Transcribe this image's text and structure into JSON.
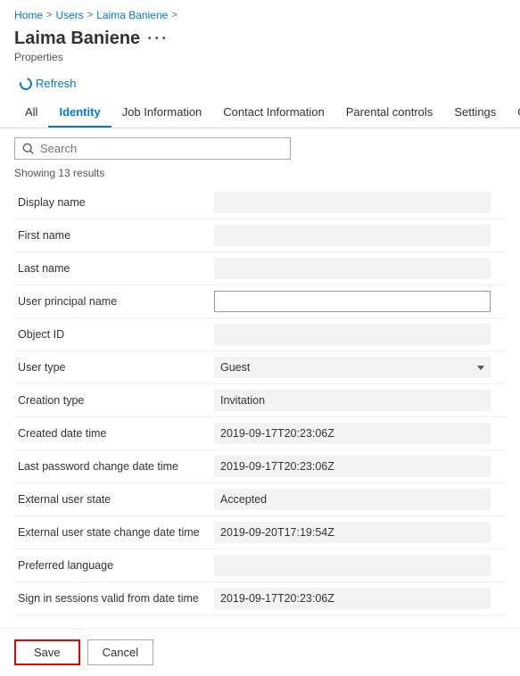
{
  "breadcrumb": {
    "home": "Home",
    "users": "Users",
    "current": "Laima Baniene",
    "sep": ">"
  },
  "page": {
    "title": "Laima Baniene",
    "ellipsis": "···",
    "subtitle": "Properties"
  },
  "toolbar": {
    "refresh_label": "Refresh"
  },
  "tabs": [
    {
      "id": "all",
      "label": "All",
      "active": false
    },
    {
      "id": "identity",
      "label": "Identity",
      "active": true
    },
    {
      "id": "job",
      "label": "Job Information",
      "active": false
    },
    {
      "id": "contact",
      "label": "Contact Information",
      "active": false
    },
    {
      "id": "parental",
      "label": "Parental controls",
      "active": false
    },
    {
      "id": "settings",
      "label": "Settings",
      "active": false
    },
    {
      "id": "onprem",
      "label": "On-premises",
      "active": false
    }
  ],
  "search": {
    "placeholder": "Search"
  },
  "results": {
    "text": "Showing 13 results"
  },
  "properties": [
    {
      "label": "Display name",
      "value": "",
      "type": "empty"
    },
    {
      "label": "First name",
      "value": "",
      "type": "empty"
    },
    {
      "label": "Last name",
      "value": "",
      "type": "empty"
    },
    {
      "label": "User principal name",
      "value": "",
      "type": "editable"
    },
    {
      "label": "Object ID",
      "value": "",
      "type": "empty"
    },
    {
      "label": "User type",
      "value": "Guest",
      "type": "dropdown"
    },
    {
      "label": "Creation type",
      "value": "Invitation",
      "type": "text"
    },
    {
      "label": "Created date time",
      "value": "2019-09-17T20:23:06Z",
      "type": "text"
    },
    {
      "label": "Last password change date time",
      "value": "2019-09-17T20:23:06Z",
      "type": "text"
    },
    {
      "label": "External user state",
      "value": "Accepted",
      "type": "text"
    },
    {
      "label": "External user state change date time",
      "value": "2019-09-20T17:19:54Z",
      "type": "text"
    },
    {
      "label": "Preferred language",
      "value": "",
      "type": "empty"
    },
    {
      "label": "Sign in sessions valid from date time",
      "value": "2019-09-17T20:23:06Z",
      "type": "text"
    }
  ],
  "footer": {
    "save_label": "Save",
    "cancel_label": "Cancel"
  }
}
